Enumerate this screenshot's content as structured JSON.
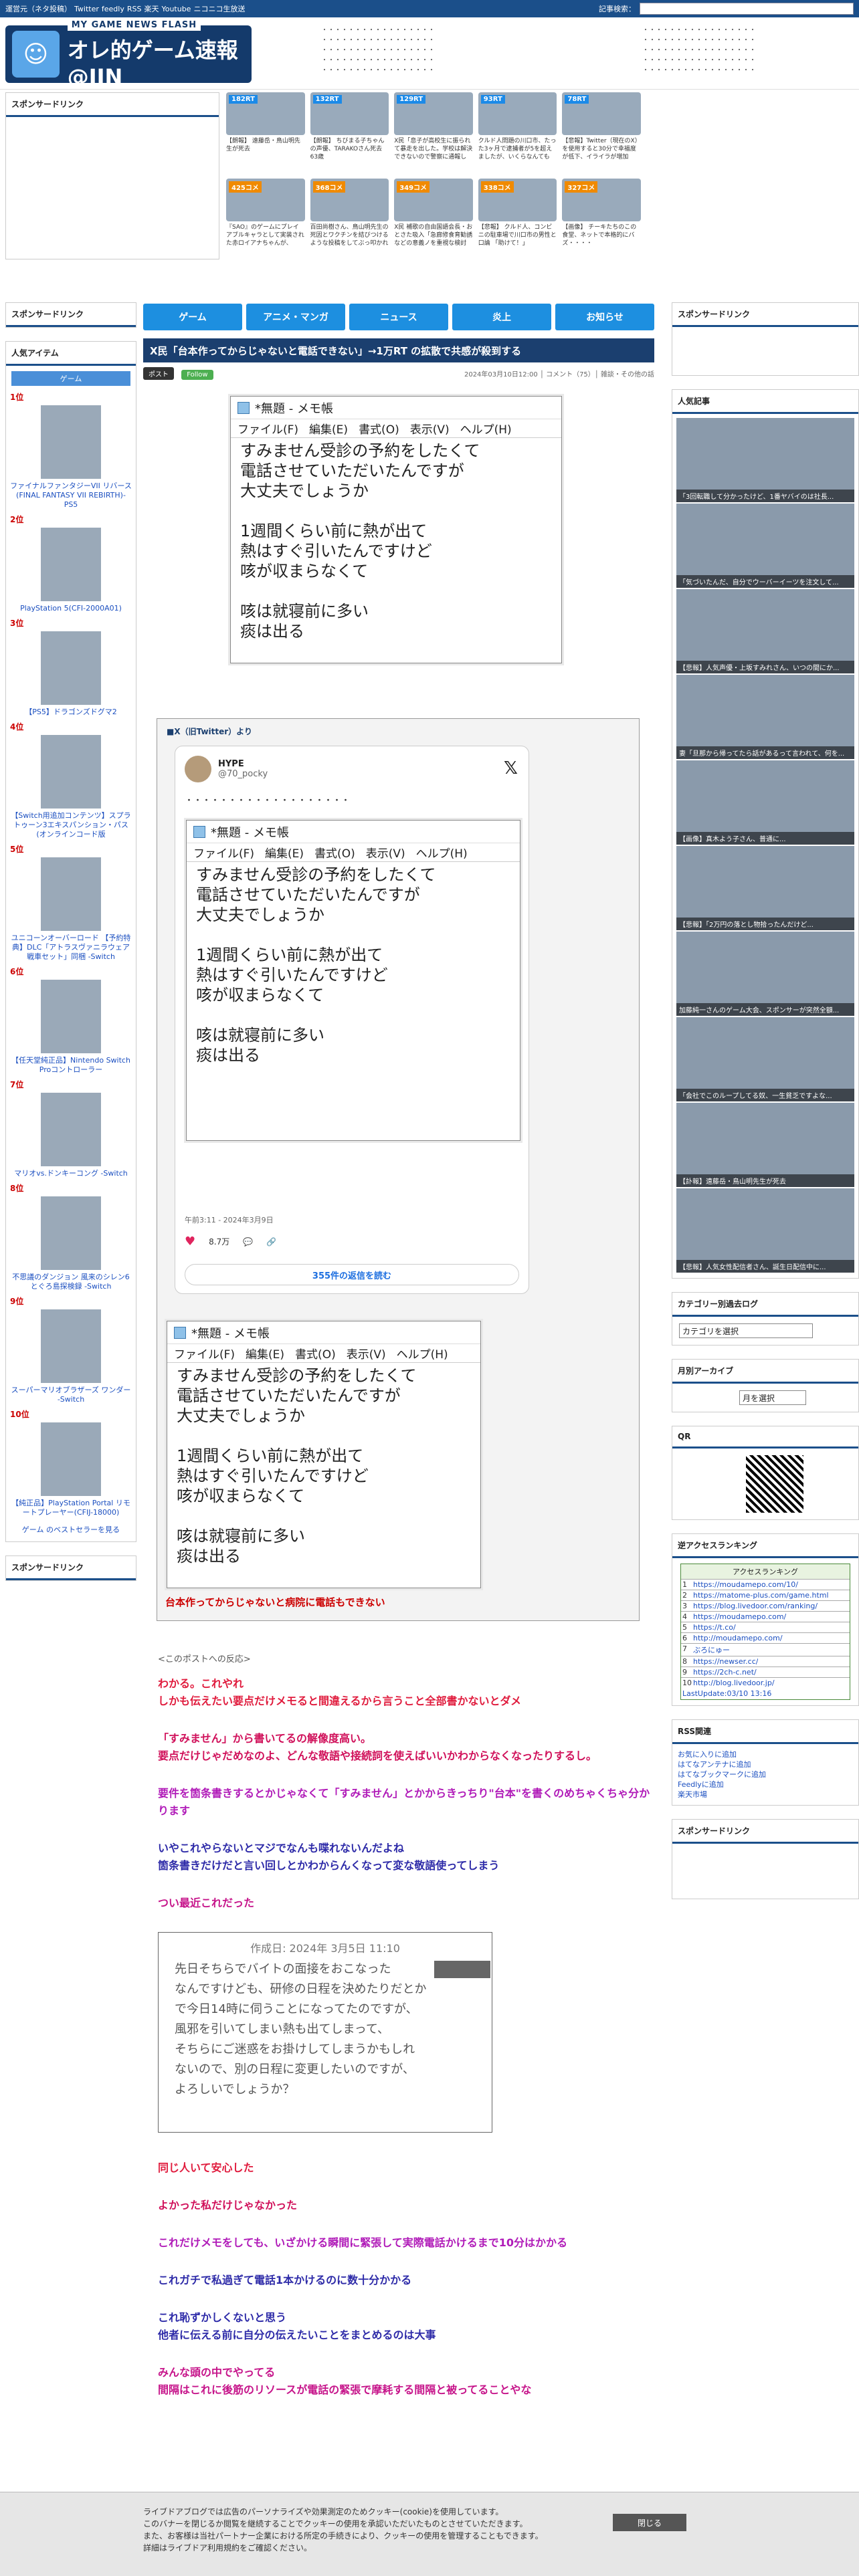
{
  "topbar": {
    "links": [
      "運営元（ネタ投稿）",
      "Twitter",
      "feedly",
      "RSS",
      "楽天",
      "Youtube",
      "ニコニコ生放送"
    ],
    "search_label": "記事検索："
  },
  "logo": {
    "sub": "MY GAME NEWS FLASH",
    "main": "オレ的ゲーム速報@JIN"
  },
  "header_news": [
    "・・・・・・・・・・・・・・・・・",
    "・・・・・・・・・・・・・・・・・",
    "・・・・・・・・・・・・・・・・・",
    "・・・・・・・・・・・・・・・・・",
    "・・・・・・・・・・・・・・・・・"
  ],
  "sponsor_label": "スポンサードリンク",
  "thumbs": [
    {
      "badge": "182RT",
      "cap": "【朗報】 遠藤岳・鳥山明先生が死去",
      "orange": false
    },
    {
      "badge": "132RT",
      "cap": "【朗報】 ちびまる子ちゃんの声優、TARAKOさん死去 63歳",
      "orange": false
    },
    {
      "badge": "129RT",
      "cap": "X民「息子が高校生に振られて暴走を出した。学校は解決できないので警察に通報し",
      "orange": false
    },
    {
      "badge": "93RT",
      "cap": "クルド人問題の川口市、たった3ヶ月で逮捕者が5を超えましたが、いくらなんても",
      "orange": false
    },
    {
      "badge": "78RT",
      "cap": "【悲報】Twitter（現在のX）を使用すると30分で幸福度が低下、イライラが増加",
      "orange": false
    },
    {
      "badge": "425コメ",
      "cap": "『SAO』のゲームにプレイアブルキャラとして実装された赤ロイアナちゃんが、",
      "orange": true
    },
    {
      "badge": "368コメ",
      "cap": "百田尚樹さん、鳥山明先生の死因とワクチンを結びつけるような投稿をしてぶっ叩かれ",
      "orange": true
    },
    {
      "badge": "349コメ",
      "cap": "X民 補歌の自由国語会長・おとさた吸入「急廊修食育勧誘などの意義ノを重視な検討",
      "orange": true
    },
    {
      "badge": "338コメ",
      "cap": "【悲報】 クルド人、コンビニの駐車場で川口市の男性と口論 「助けて！」",
      "orange": true
    },
    {
      "badge": "327コメ",
      "cap": "【画像】 チーキたちのこの食堂、ネットで本格的にバズ・・・・",
      "orange": true
    }
  ],
  "nav": [
    "ゲーム",
    "アニメ・マンガ",
    "ニュース",
    "炎上",
    "お知らせ"
  ],
  "article": {
    "title": "X民「台本作ってからじゃないと電話できない」→1万RT の拡散で共感が殺到する",
    "share_label": "ポスト",
    "follow_label": "Follow",
    "meta": "2024年03月10日12:00 │ コメント（75）│ 雑談・その他の話"
  },
  "notepad": {
    "title": "*無題 - メモ帳",
    "menu": [
      "ファイル(F)",
      "編集(E)",
      "書式(O)",
      "表示(V)",
      "ヘルプ(H)"
    ],
    "body": "すみません受診の予約をしたくて\n電話させていただいたんですが\n大丈夫でしょうか\n\n1週間くらい前に熱が出て\n熱はすぐ引いたんですけど\n咳が収まらなくて\n\n咳は就寝前に多い\n痰は出る"
  },
  "embed": {
    "label": "■X（旧Twitter）より",
    "handle": "@70_pocky",
    "time": "午前3:11 - 2024年3月9日",
    "likes": "8.7万",
    "more": "355件の返信を読む",
    "caption": "台本作ってからじゃないと病院に電話もできない"
  },
  "comments_intro": "<このポストへの反応>",
  "comments": [
    {
      "text": "わかる。これやれ\nしかも伝えたい要点だけメモると間違えるから言うこと全部書かないとダメ",
      "cls": "c-red"
    },
    {
      "text": "「すみません」から書いてるの解像度高い。\n要点だけじゃだめなのよ、どんな敬語や接続詞を使えばいいかわからなくなったりするし。",
      "cls": "c-pink"
    },
    {
      "text": "要件を箇条書きするとかじゃなくて「すみません」とかからきっちり\"台本\"を書くのめちゃくちゃ分かります",
      "cls": "c-purple"
    },
    {
      "text": "いやこれやらないとマジでなんも喋れないんだよね\n箇条書きだけだと言い回しとかわからんくなって変な敬語使ってしまう",
      "cls": "c-blue"
    },
    {
      "text": "つい最近これだった",
      "cls": "c-mag"
    }
  ],
  "quote": {
    "date": "作成日: 2024年 3月5日 11:10",
    "body": "先日そちらでバイトの面接をおこなった\nなんですけども、研修の日程を決めたりだとか\nで今日14時に伺うことになってたのですが、\n風邪を引いてしまい熱も出てしまって、\nそちらにご迷惑をお掛けしてしまうかもしれ\nないので、別の日程に変更したいのですが、\nよろしいでしょうか？"
  },
  "comments2": [
    {
      "text": "同じ人いて安心した",
      "cls": "c-red"
    },
    {
      "text": "よかった私だけじゃなかった",
      "cls": "c-pink"
    },
    {
      "text": "これだけメモをしても、いざかける瞬間に緊張して実際電話かけるまで10分はかかる",
      "cls": "c-purple"
    },
    {
      "text": "これガチで私過ぎて電話1本かけるのに数十分かかる",
      "cls": "c-blue"
    },
    {
      "text": "これ恥ずかしくないと思う\n他者に伝える前に自分の伝えたいことをまとめるのは大事",
      "cls": "c-blue"
    },
    {
      "text": "みんな頭の中でやってる\n間隔はこれに後筋のリソースが電話の緊張で摩耗する間隔と被ってることやな",
      "cls": "c-mag"
    }
  ],
  "left": {
    "popular_title": "人気アイテム",
    "game_btn": "ゲーム",
    "items": [
      {
        "rank": "1位",
        "name": "ファイナルファンタジーVII リバース(FINAL FANTASY VII REBIRTH)-PS5"
      },
      {
        "rank": "2位",
        "name": "PlayStation 5(CFI-2000A01)"
      },
      {
        "rank": "3位",
        "name": "【PS5】ドラゴンズドグマ2"
      },
      {
        "rank": "4位",
        "name": "【Switch用追加コンテンツ】スプラトゥーン3エキスパンション・パス(オンラインコード版"
      },
      {
        "rank": "5位",
        "name": "ユニコーンオーバーロード 【予約特典】DLC「アトラスヴァニラウェア 戦車セット」同梱 -Switch"
      },
      {
        "rank": "6位",
        "name": "【任天堂純正品】Nintendo Switch Proコントローラー"
      },
      {
        "rank": "7位",
        "name": "マリオvs.ドンキーコング -Switch"
      },
      {
        "rank": "8位",
        "name": "不思議のダンジョン 風来のシレン6 とぐろ島探検録 -Switch"
      },
      {
        "rank": "9位",
        "name": "スーパーマリオブラザーズ ワンダー -Switch"
      },
      {
        "rank": "10位",
        "name": "【純正品】PlayStation Portal リモートプレーヤー(CFIJ-18000)"
      }
    ],
    "best_seller": "ゲーム のベストセラーを見る",
    "sponsor": "スポンサードリンク"
  },
  "right": {
    "sponsor": "スポンサードリンク",
    "popular_title": "人気記事",
    "popular": [
      "「3回転職して分かったけど、1番ヤバイのは社長...",
      "「気づいたんだ、自分でウーバーイーツを注文して...",
      "【悲報】人気声優・上坂すみれさん、いつの間にか...",
      "妻「旦那から帰ってたら話があるって言われて、何を...",
      "【画像】真木よう子さん、普通に...",
      "【悲報】「2万円の落とし物拾ったんだけど...",
      "加藤純一さんのゲーム大会、スポンサーが突然全額...",
      "「会社でこのループしてる奴、一生貧乏ですよな...",
      "【訃報】遠藤岳・鳥山明先生が死去",
      "【悲報】人気女性配信者さん、誕生日配信中に..."
    ],
    "cat_title": "カテゴリー別過去ログ",
    "cat_select": "カテゴリを選択",
    "month_title": "月別アーカイブ",
    "month_select": "月を選択",
    "qr_title": "QR",
    "acc_title": "逆アクセスランキング",
    "acc_head": "アクセスランキング",
    "acc_rows": [
      "https://moudamepo.com/10/",
      "https://matome-plus.com/game.html",
      "https://blog.livedoor.com/ranking/",
      "https://moudamepo.com/",
      "https://t.co/",
      "http://moudamepo.com/",
      "ぶろにゅー",
      "https://newser.cc/",
      "https://2ch-c.net/",
      "http://blog.livedoor.jp/"
    ],
    "acc_footer": "LastUpdate:03/10 13:16",
    "rss_title": "RSS関連",
    "rss": [
      "お気に入りに追加",
      "はてなアンテナに追加",
      "はてなブックマークに追加",
      "Feedlyに追加",
      "楽天市場"
    ],
    "sponsor2": "スポンサードリンク"
  },
  "cookie": {
    "text": "ライブドアブログでは広告のパーソナライズや効果測定のためクッキー(cookie)を使用しています。\nこのバナーを閉じるか閲覧を継続することでクッキーの使用を承認いただいたものとさせていただきます。\nまた、お客様は当社パートナー企業における所定の手続きにより、クッキーの使用を管理することもできます。\n詳細はライブドア利用規約をご確認ください。",
    "close": "閉じる"
  }
}
